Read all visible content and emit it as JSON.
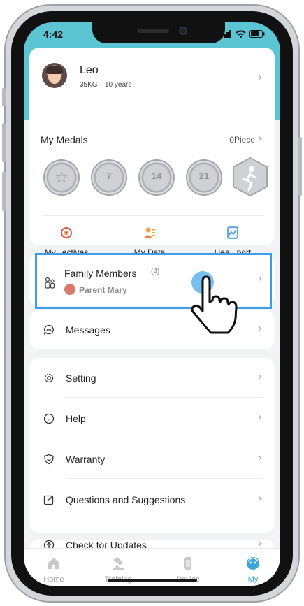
{
  "status_bar": {
    "time": "4:42"
  },
  "profile": {
    "name": "Leo",
    "weight": "35KG",
    "age": "10 years"
  },
  "medals": {
    "title": "My Medals",
    "count": "0Piece",
    "items": [
      {
        "icon": "star-medal-icon",
        "label": ""
      },
      {
        "icon": "medal-7-icon",
        "label": "7"
      },
      {
        "icon": "medal-14-icon",
        "label": "14"
      },
      {
        "icon": "medal-21-icon",
        "label": "21"
      },
      {
        "icon": "runner-badge-icon",
        "label": ""
      }
    ]
  },
  "quick_links": [
    {
      "icon": "target-icon",
      "label": "My...ectives"
    },
    {
      "icon": "person-data-icon",
      "label": "My Data"
    },
    {
      "icon": "health-report-icon",
      "label": "Hea...port"
    }
  ],
  "family": {
    "title": "Family Members",
    "count": "(4)",
    "parent": "Parent Mary"
  },
  "messages": {
    "label": "Messages"
  },
  "menu": [
    {
      "icon": "gear-icon",
      "label": "Setting"
    },
    {
      "icon": "help-icon",
      "label": "Help"
    },
    {
      "icon": "shield-icon",
      "label": "Warranty"
    },
    {
      "icon": "edit-icon",
      "label": "Questions and Suggestions"
    }
  ],
  "updates": {
    "label": "Check for Updates"
  },
  "tabs": [
    {
      "icon": "home-icon",
      "label": "Home",
      "active": false
    },
    {
      "icon": "training-icon",
      "label": "Training",
      "active": false
    },
    {
      "icon": "device-icon",
      "label": "Device",
      "active": false
    },
    {
      "icon": "my-icon",
      "label": "My",
      "active": true
    }
  ],
  "colors": {
    "accent": "#5cc5d3",
    "highlight": "#3d9ee6",
    "active_tab": "#3ba6d8"
  }
}
